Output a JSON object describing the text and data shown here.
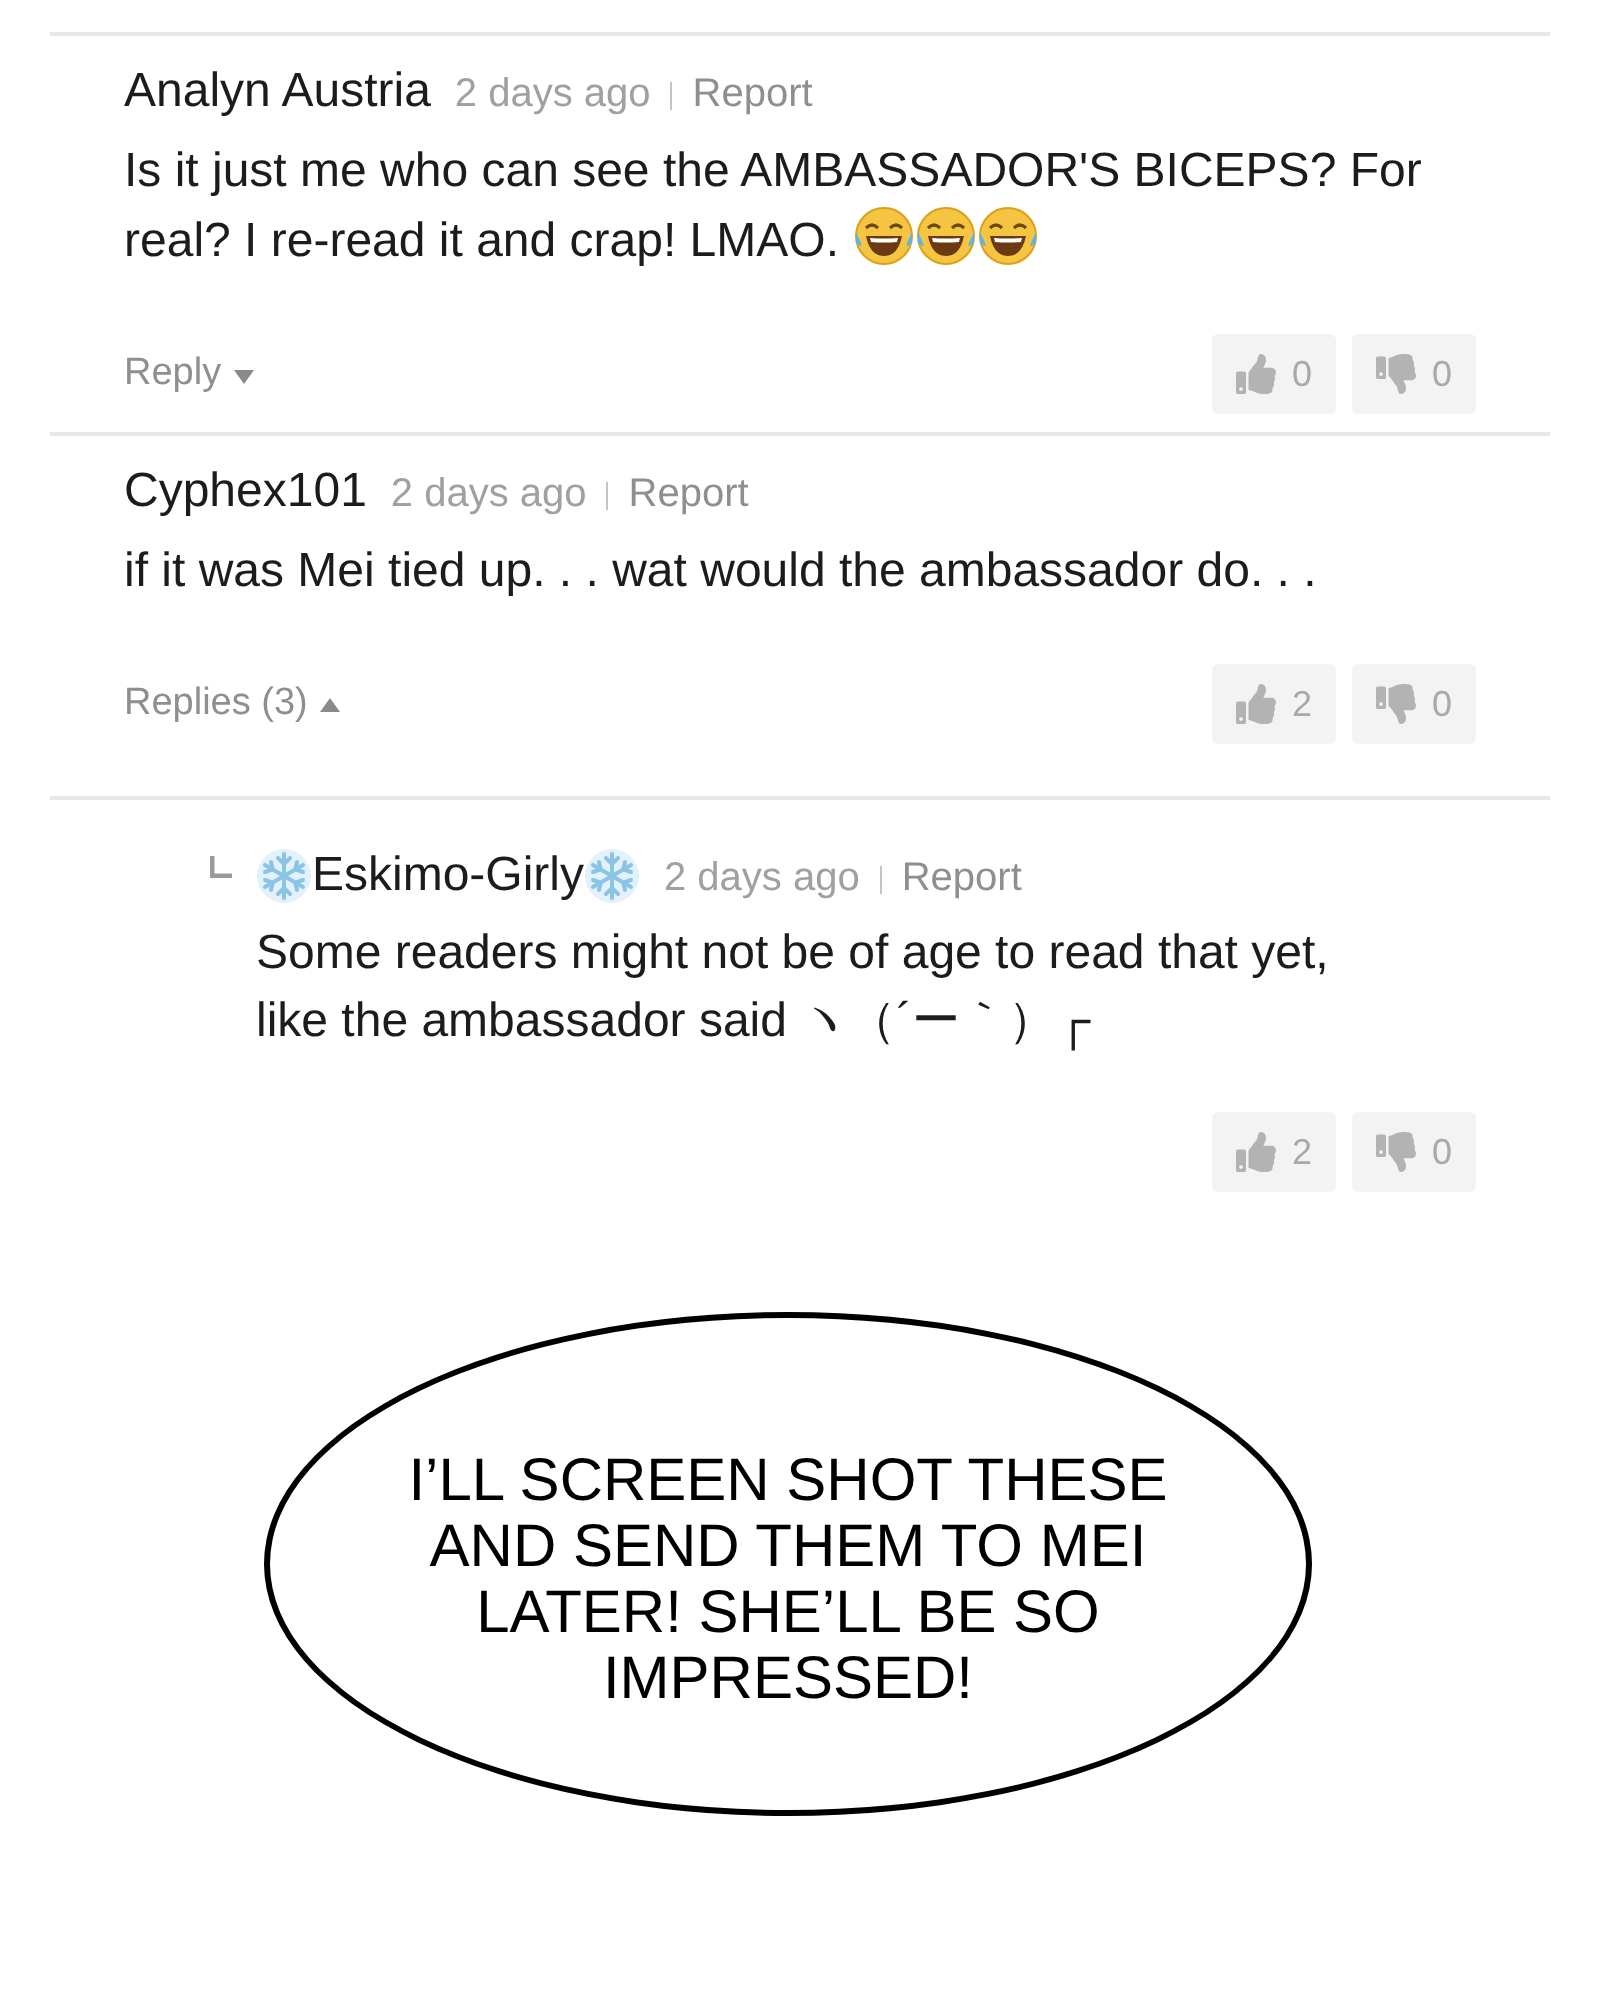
{
  "comments": [
    {
      "author": "Analyn Austria",
      "time": "2 days ago",
      "report": "Report",
      "body": "Is it just me who can see the AMBASSADOR'S BICEPS? For real? I re-read it and crap! LMAO.",
      "body_icons": [
        {
          "kind": "laughing-face"
        },
        {
          "kind": "laughing-face"
        },
        {
          "kind": "laughing-face"
        }
      ],
      "likes": "0",
      "dislikes": "0",
      "replies_toggle": {
        "label": "Reply",
        "expanded": false
      }
    },
    {
      "author": "Cyphex101",
      "time": "2 days ago",
      "report": "Report",
      "body": "if it was Mei tied up. . . wat would the ambassador do. . .",
      "likes": "2",
      "dislikes": "0",
      "replies_toggle": {
        "label": "Replies (3)",
        "expanded": true
      },
      "replies": [
        {
          "author": "Eskimo-Girly",
          "icons_before_name": [
            {
              "kind": "snowflake"
            }
          ],
          "icons_after_name": [
            {
              "kind": "snowflake"
            }
          ],
          "time": "2 days ago",
          "report": "Report",
          "body": "Some readers might not be of age to read that yet, like the ambassador said ヽ（´ー｀）┌",
          "likes": "2",
          "dislikes": "0"
        }
      ]
    }
  ],
  "speech_bubble": {
    "text": "I’LL SCREEN SHOT THESE AND SEND THEM TO MEI LATER! SHE’LL BE SO IMPRESSED!"
  }
}
